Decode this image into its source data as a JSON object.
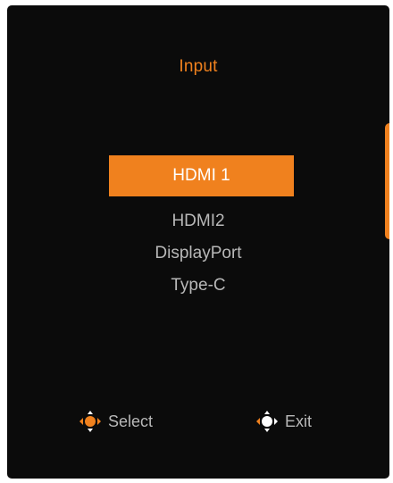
{
  "colors": {
    "background": "#0b0b0b",
    "accent": "#f0811e",
    "text": "#b8b8b8",
    "selected_text": "#ffffff",
    "title": "#f0811e"
  },
  "osd": {
    "title": "Input",
    "side_tab_icon": "orange-side-tab"
  },
  "menu": {
    "items": [
      {
        "label": "HDMI 1",
        "selected": true
      },
      {
        "label": "HDMI2",
        "selected": false
      },
      {
        "label": "DisplayPort",
        "selected": false
      },
      {
        "label": "Type-C",
        "selected": false
      }
    ]
  },
  "footer": {
    "select": {
      "label": "Select",
      "icon": "joystick-select-icon"
    },
    "exit": {
      "label": "Exit",
      "icon": "joystick-exit-icon"
    }
  }
}
